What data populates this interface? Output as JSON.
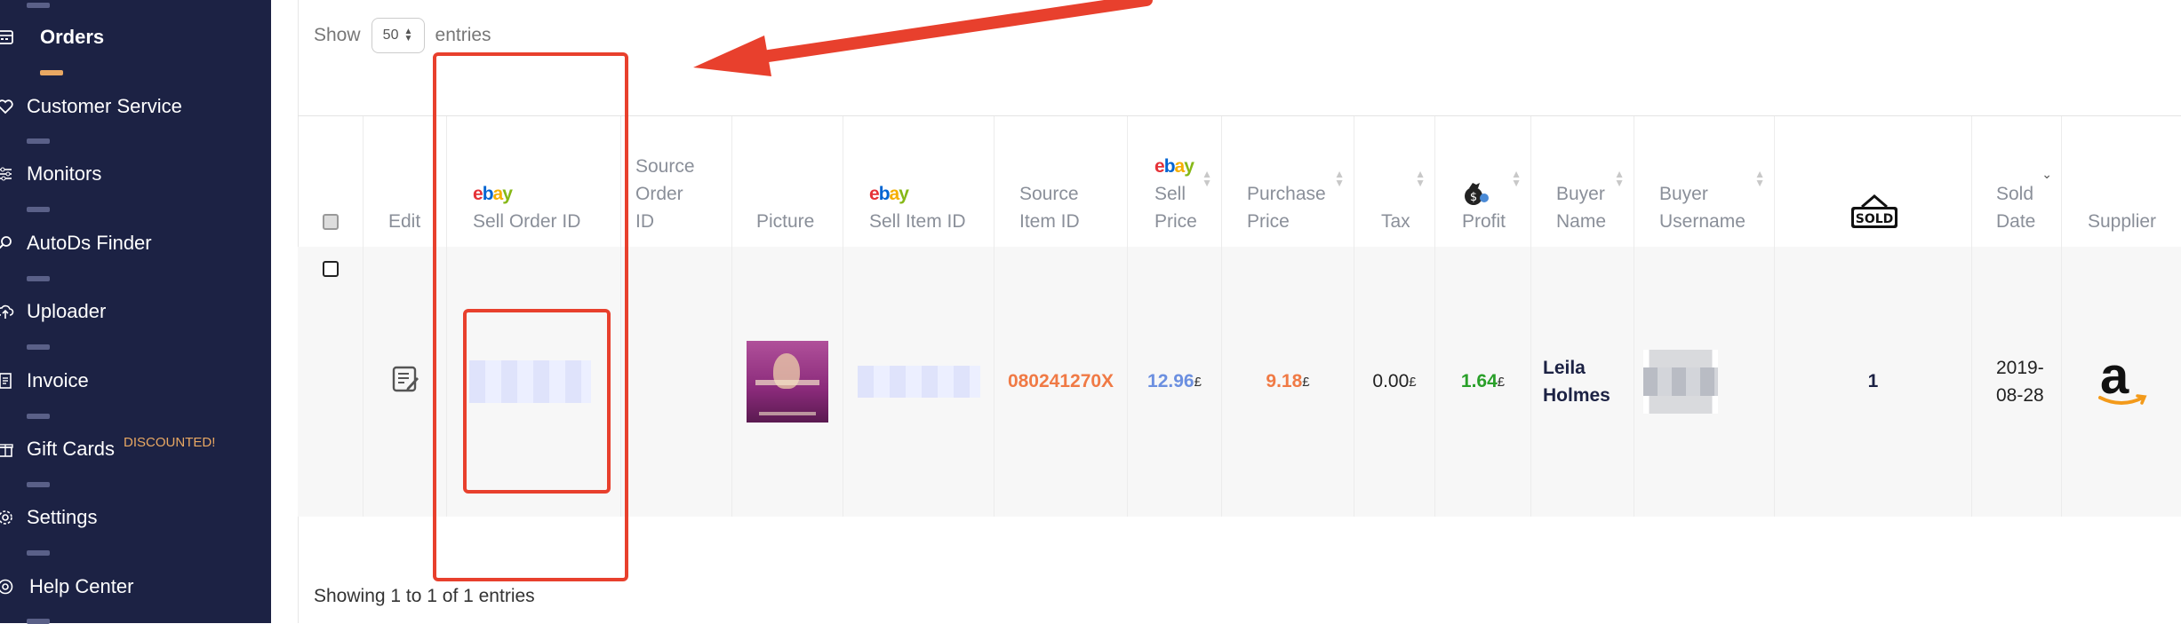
{
  "sidebar": {
    "items": [
      {
        "label": "Orders",
        "icon": "orders-icon",
        "active": true
      },
      {
        "label": "Customer Service",
        "icon": "heart-icon"
      },
      {
        "label": "Monitors",
        "icon": "sliders-icon"
      },
      {
        "label": "AutoDs Finder",
        "icon": "magnifier-icon"
      },
      {
        "label": "Uploader",
        "icon": "cloud-upload-icon"
      },
      {
        "label": "Invoice",
        "icon": "invoice-icon"
      },
      {
        "label": "Gift Cards",
        "icon": "gift-icon",
        "badge": "DISCOUNTED!"
      },
      {
        "label": "Settings",
        "icon": "gear-icon"
      },
      {
        "label": "Help Center",
        "icon": "lifebuoy-icon"
      }
    ]
  },
  "toolbar": {
    "show_label": "Show",
    "page_size": "50",
    "entries_label": "entries"
  },
  "table": {
    "headers": {
      "edit": "Edit",
      "sell_order_id": "Sell Order ID",
      "source_order_id": "Source\nOrder\nID",
      "picture": "Picture",
      "sell_item_id": "Sell Item ID",
      "source_item_id": "Source\nItem ID",
      "sell_price": "Sell\nPrice",
      "purchase_price": "Purchase\nPrice",
      "tax": "Tax",
      "profit": "Profit",
      "buyer_name": "Buyer\nName",
      "buyer_username": "Buyer\nUsername",
      "sold_date": "Sold\nDate",
      "supplier": "Supplier",
      "ebay_logo": "ebay",
      "sold_icon_label": "SOLD"
    },
    "row": {
      "source_item_id": "080241270X",
      "sell_price": "12.96",
      "purchase_price": "9.18",
      "tax": "0.00",
      "profit": "1.64",
      "currency": "£",
      "buyer_name": "Leila\nHolmes",
      "quantity": "1",
      "sold_date": "2019-\n08-28",
      "supplier_logo": "a"
    },
    "colors": {
      "source_item_id": "#f07a45",
      "sell_price": "#6b8fe0",
      "purchase_price": "#f07a45",
      "profit": "#2aa02a"
    }
  },
  "footer": {
    "info": "Showing 1 to 1 of 1 entries"
  }
}
